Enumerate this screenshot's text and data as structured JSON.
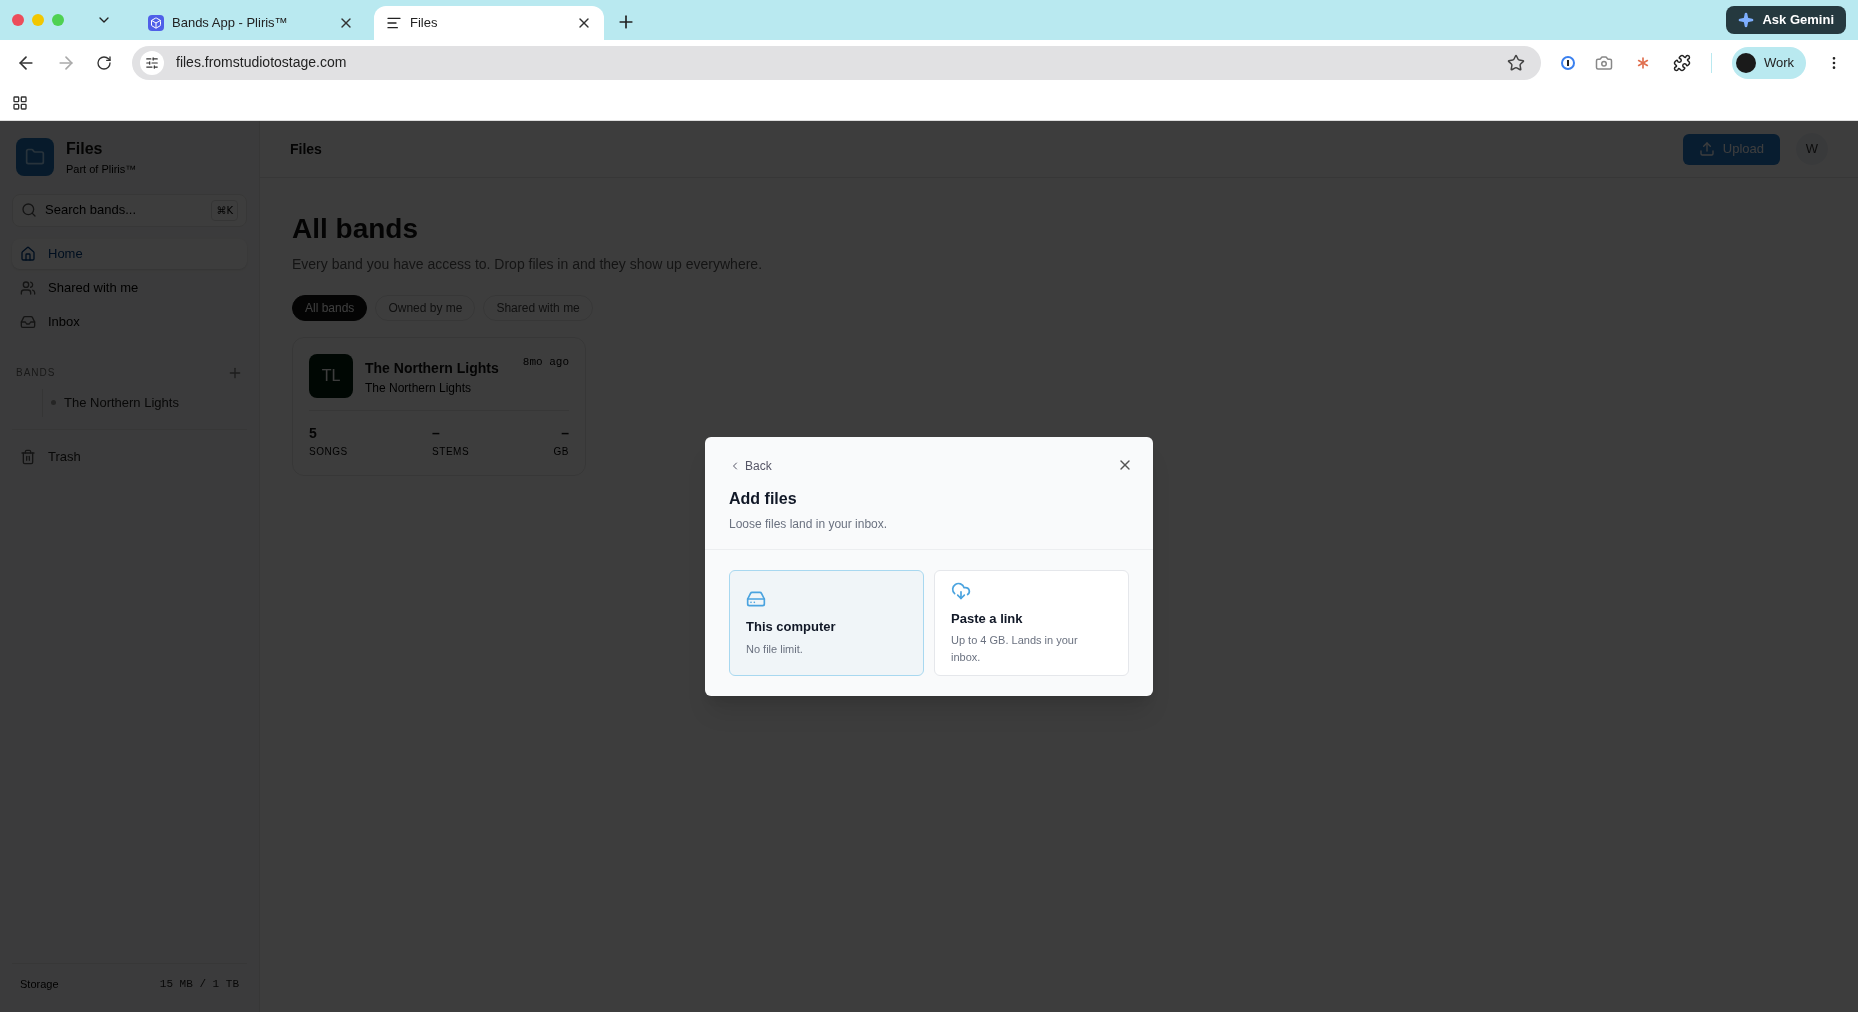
{
  "browser": {
    "tabs": [
      {
        "title": "Bands App - Pliris™",
        "selected": false,
        "kind": "app"
      },
      {
        "title": "Files",
        "selected": true,
        "kind": "files"
      }
    ],
    "address": "files.fromstudiotostage.com",
    "ask_button": "Ask Gemini",
    "profile": "Work"
  },
  "sidebar": {
    "app_name": "Files",
    "app_subtitle": "Part of Pliris™",
    "search": {
      "placeholder": "Search bands...",
      "shortcut": "⌘K"
    },
    "nav": [
      {
        "label": "Home",
        "selected": true,
        "kind": "home"
      },
      {
        "label": "Shared with me",
        "selected": false,
        "kind": "shared"
      },
      {
        "label": "Inbox",
        "selected": false,
        "kind": "inbox"
      }
    ],
    "bands_heading": "BANDS",
    "bands": [
      {
        "name": "The Northern Lights"
      }
    ],
    "trash": "Trash",
    "storage_label": "Storage",
    "storage_value": "15 MB / 1 TB"
  },
  "header": {
    "title": "Files",
    "upload": "Upload",
    "avatar": "W"
  },
  "main": {
    "heading": "All bands",
    "subtitle": "Every band you have access to. Drop files in and they show up everywhere.",
    "filters": [
      {
        "label": "All bands",
        "selected": true
      },
      {
        "label": "Owned by me",
        "selected": false
      },
      {
        "label": "Shared with me",
        "selected": false
      }
    ],
    "cards": [
      {
        "initials": "TL",
        "name": "The Northern Lights",
        "subtitle": "The Northern Lights",
        "time": "8mo ago",
        "stats": [
          {
            "value": "5",
            "label": "SONGS"
          },
          {
            "value": "–",
            "label": "STEMS"
          },
          {
            "value": "–",
            "label": "GB"
          }
        ]
      }
    ]
  },
  "modal": {
    "back": "Back",
    "title": "Add files",
    "subtitle": "Loose files land in your inbox.",
    "options": [
      {
        "kind": "computer",
        "title": "This computer",
        "description": "No file limit.",
        "selected": true
      },
      {
        "kind": "link",
        "title": "Paste a link",
        "description": "Up to 4 GB. Lands in your inbox.",
        "selected": false
      }
    ]
  }
}
